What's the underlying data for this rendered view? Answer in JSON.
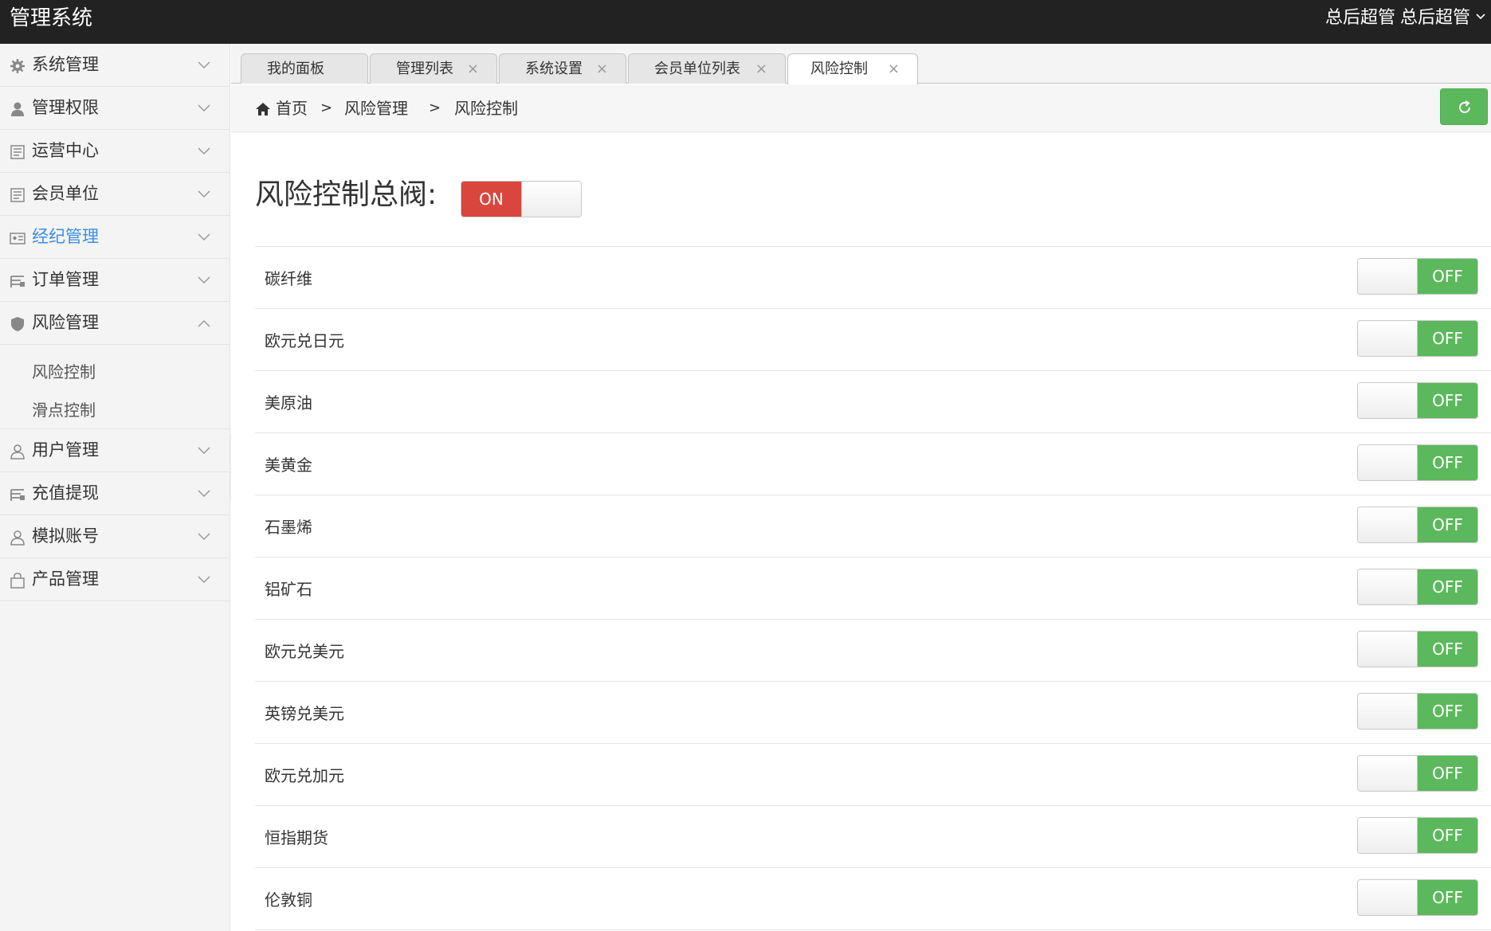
{
  "app": {
    "title": "管理系统"
  },
  "header": {
    "user_a": "总后超管",
    "user_b": "总后超管"
  },
  "sidebar": {
    "items": [
      {
        "label": "系统管理",
        "icon": "gear-icon"
      },
      {
        "label": "管理权限",
        "icon": "user-icon"
      },
      {
        "label": "运营中心",
        "icon": "document-icon"
      },
      {
        "label": "会员单位",
        "icon": "document-icon"
      },
      {
        "label": "经纪管理",
        "icon": "id-card-icon",
        "active": true
      },
      {
        "label": "订单管理",
        "icon": "list-icon"
      },
      {
        "label": "风险管理",
        "icon": "shield-icon",
        "expanded": true
      },
      {
        "label": "用户管理",
        "icon": "user-outline-icon"
      },
      {
        "label": "充值提现",
        "icon": "list-icon"
      },
      {
        "label": "模拟账号",
        "icon": "user-outline-icon"
      },
      {
        "label": "产品管理",
        "icon": "bag-icon"
      }
    ],
    "sub_items": [
      "风险控制",
      "滑点控制"
    ]
  },
  "tabs": [
    {
      "label": "我的面板",
      "closable": false
    },
    {
      "label": "管理列表",
      "closable": true
    },
    {
      "label": "系统设置",
      "closable": true
    },
    {
      "label": "会员单位列表",
      "closable": true
    },
    {
      "label": "风险控制",
      "closable": true,
      "active": true
    }
  ],
  "tab_close_glyph": "×",
  "breadcrumb": {
    "home": "首页",
    "sep": ">",
    "level1": "风险管理",
    "level2": "风险控制"
  },
  "main": {
    "master_label": "风险控制总阀:",
    "master_state": "ON",
    "rows": [
      {
        "label": "碳纤维",
        "state": "OFF"
      },
      {
        "label": "欧元兑日元",
        "state": "OFF"
      },
      {
        "label": "美原油",
        "state": "OFF"
      },
      {
        "label": "美黄金",
        "state": "OFF"
      },
      {
        "label": "石墨烯",
        "state": "OFF"
      },
      {
        "label": "铝矿石",
        "state": "OFF"
      },
      {
        "label": "欧元兑美元",
        "state": "OFF"
      },
      {
        "label": "英镑兑美元",
        "state": "OFF"
      },
      {
        "label": "欧元兑加元",
        "state": "OFF"
      },
      {
        "label": "恒指期货",
        "state": "OFF"
      },
      {
        "label": "伦敦铜",
        "state": "OFF"
      }
    ]
  },
  "colors": {
    "topbar": "#222222",
    "on": "#d9463e",
    "off": "#5cb85c",
    "active_nav": "#3a8ee6",
    "refresh": "#5cb85c"
  }
}
